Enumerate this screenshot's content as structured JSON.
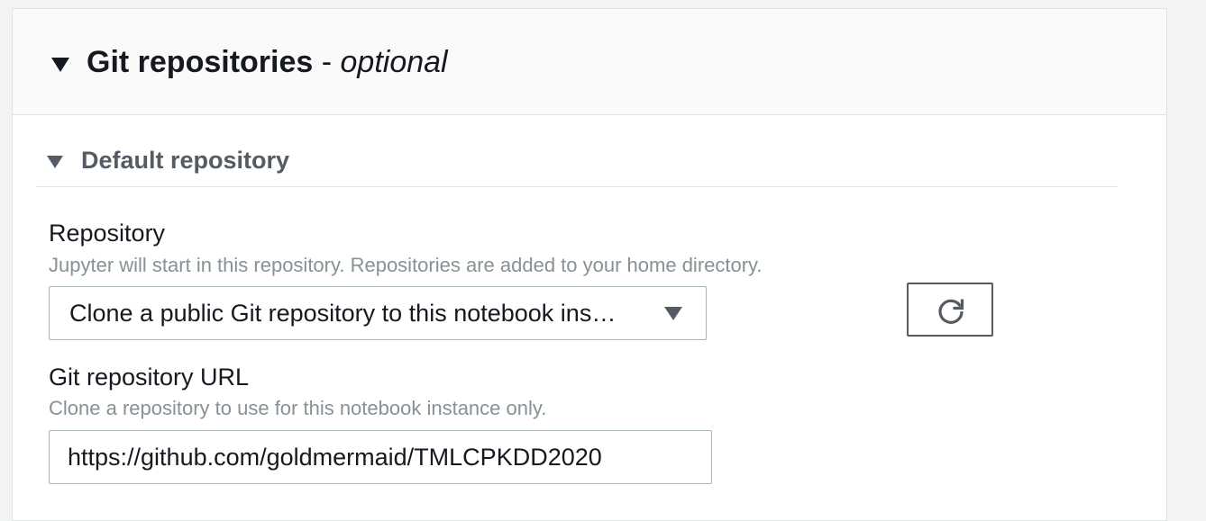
{
  "section": {
    "title": "Git repositories",
    "separator": "-",
    "optional_label": "optional",
    "expanded_icon": "caret-down-icon"
  },
  "default_repository": {
    "title": "Default repository",
    "expanded_icon": "caret-down-icon"
  },
  "repository_field": {
    "label": "Repository",
    "description": "Jupyter will start in this repository. Repositories are added to your home directory.",
    "selected_value": "Clone a public Git repository to this notebook ins…",
    "dropdown_icon": "caret-down-icon",
    "refresh_icon": "refresh-icon"
  },
  "git_url_field": {
    "label": "Git repository URL",
    "description": "Clone a repository to use for this notebook instance only.",
    "value": "https://github.com/goldmermaid/TMLCPKDD2020"
  },
  "colors": {
    "background": "#f2f3f3",
    "panel": "#ffffff",
    "header": "#fafafa",
    "text": "#16191f",
    "secondary_text": "#545b64",
    "muted_text": "#879196",
    "border": "#aab7b8"
  }
}
